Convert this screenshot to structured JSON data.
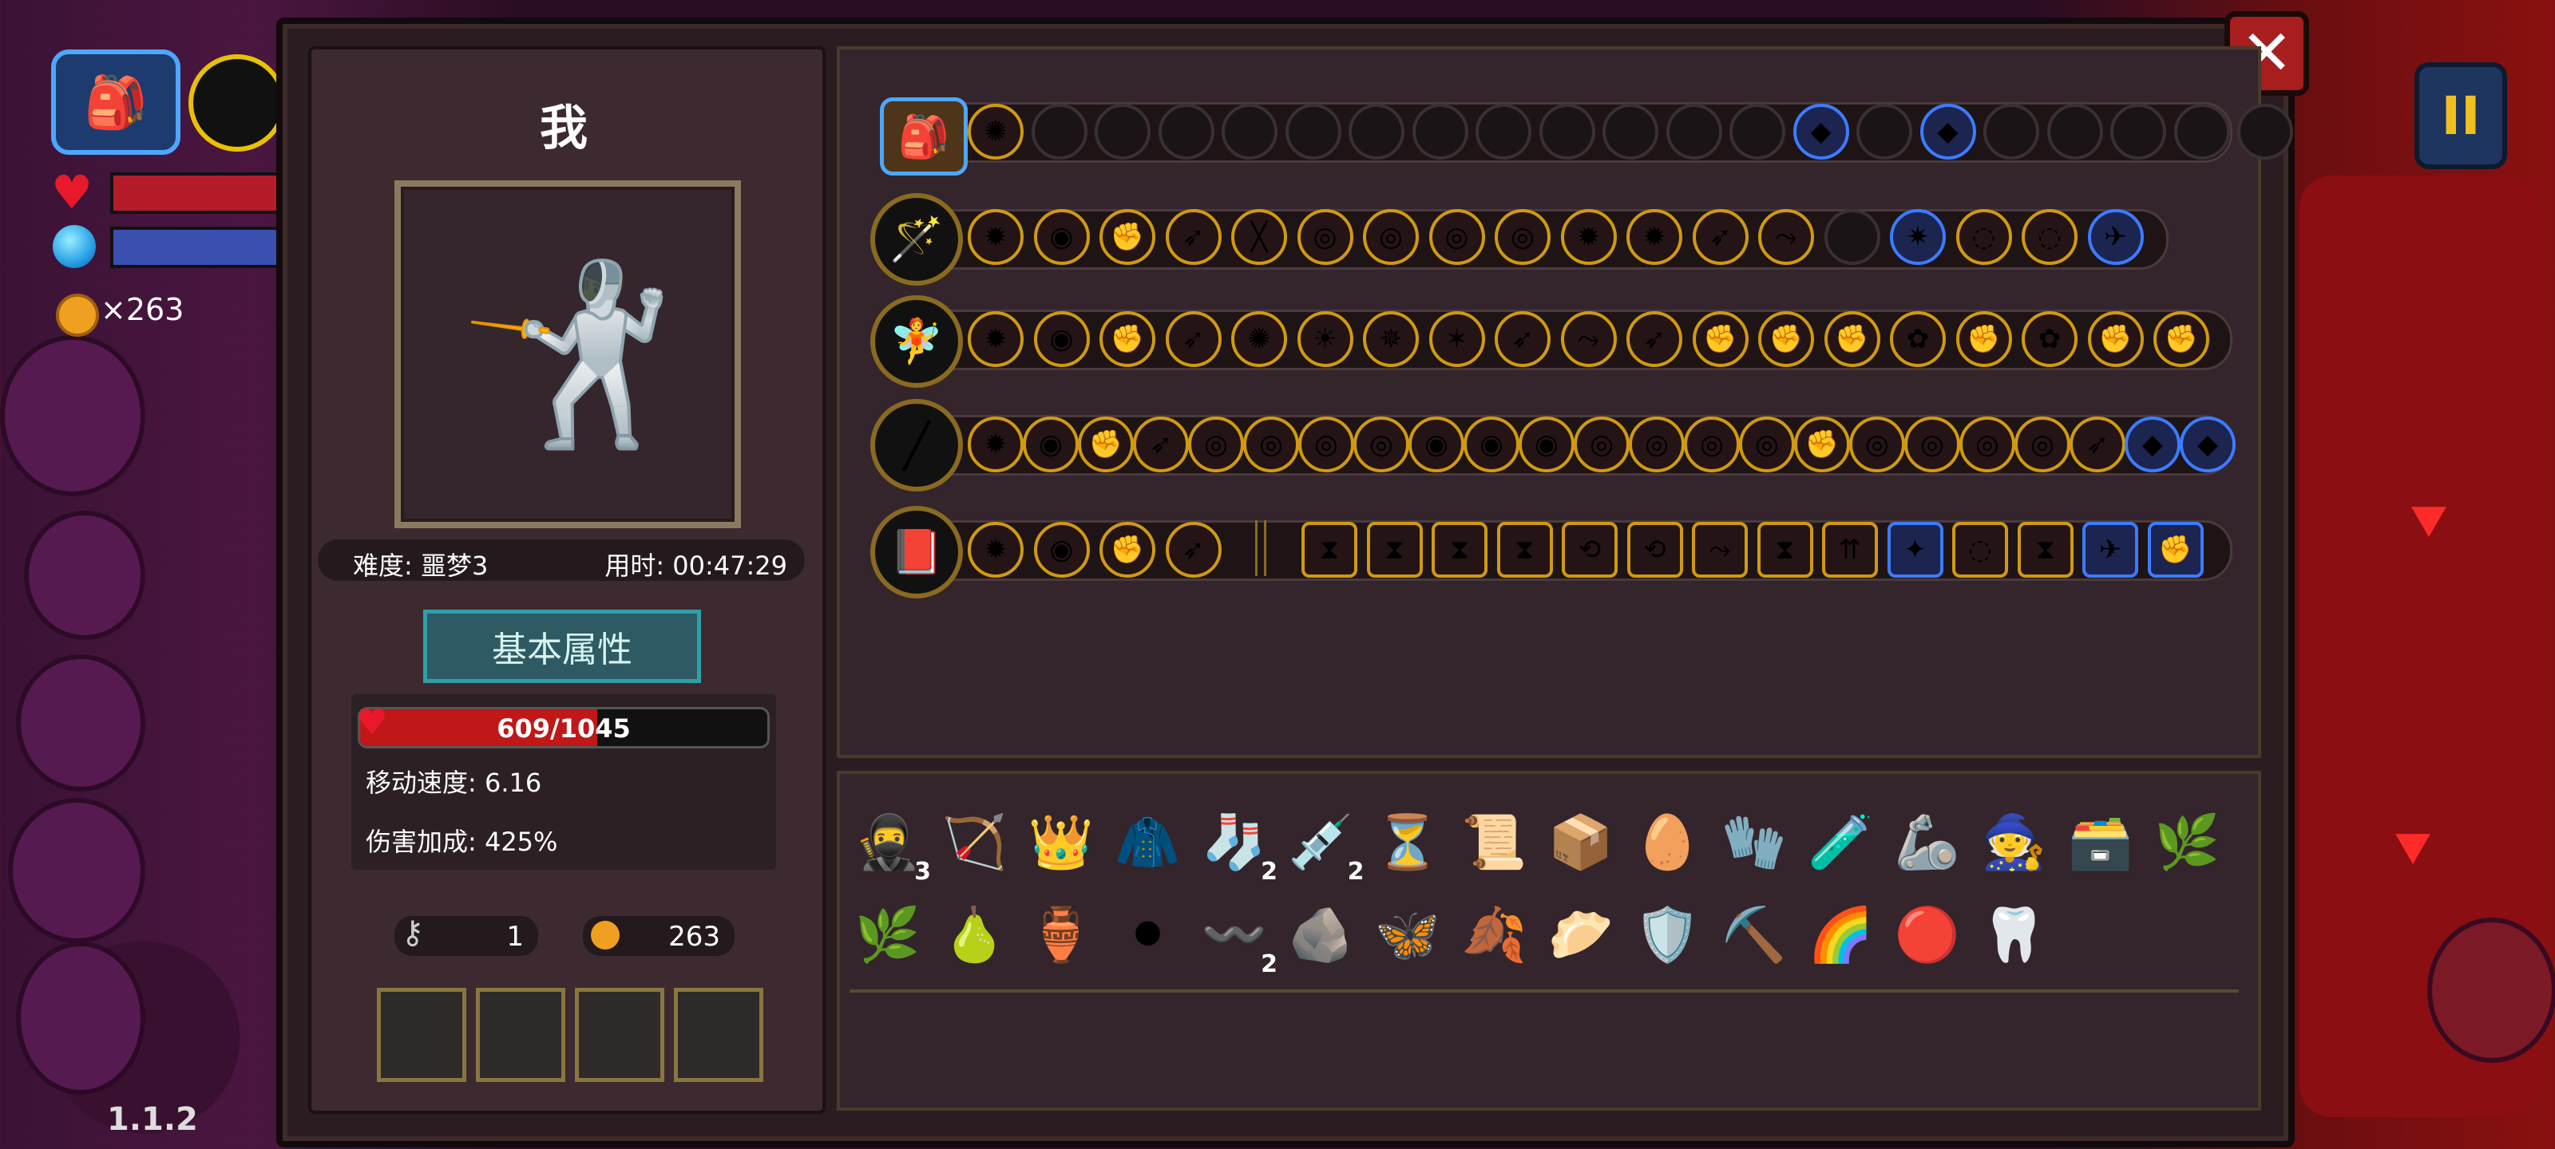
{
  "hud": {
    "coins": "×263",
    "version": "1.1.2"
  },
  "panel": {
    "player_name": "我",
    "difficulty": "难度: 噩梦3",
    "elapsed": "用时: 00:47:29",
    "basic_attr_tab": "基本属性",
    "hp_text": "609/1045",
    "hp_fraction": 0.583,
    "move_speed": "移动速度: 6.16",
    "damage_bonus": "伤害加成: 425%",
    "keys": "1",
    "gold": "263"
  },
  "colors": {
    "accent_gold": "#d09a10",
    "hp_red": "#c01818",
    "mana_blue": "#3b4fb0",
    "tab_teal": "#2fa0a8"
  },
  "inventory": {
    "row1_counts": [
      "3",
      "2",
      "2"
    ],
    "row2_counts": [
      "2"
    ]
  },
  "icons": {
    "close": "close-icon",
    "pause": "pause-icon"
  }
}
